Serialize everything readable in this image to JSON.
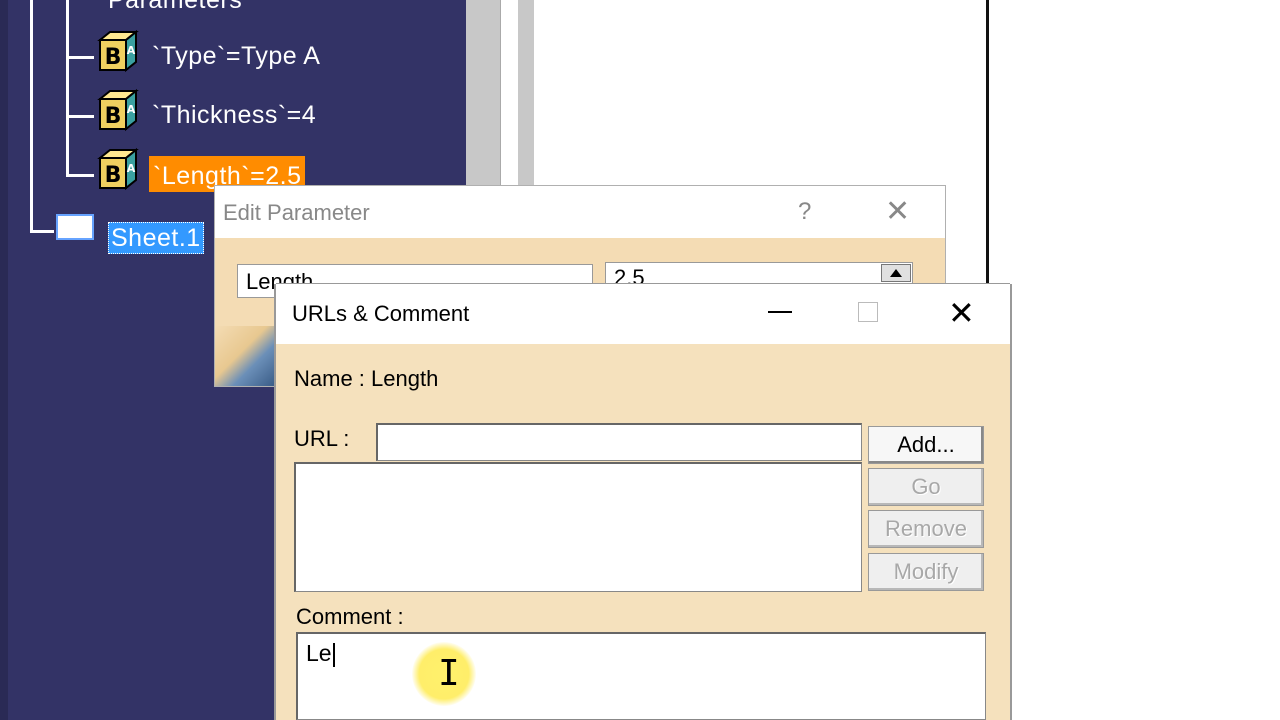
{
  "tree": {
    "root_label": "Parameters",
    "items": [
      {
        "label": "`Type`=Type A",
        "icon": "parameter-icon",
        "selected": false
      },
      {
        "label": "`Thickness`=4",
        "icon": "parameter-icon",
        "selected": false
      },
      {
        "label": "`Length`=2.5",
        "icon": "parameter-icon",
        "selected": true
      }
    ],
    "sheet_label": "Sheet.1"
  },
  "edit_dialog": {
    "title": "Edit Parameter",
    "help_label": "?",
    "close_label": "✕",
    "name_value": "Length",
    "value_value": "2.5"
  },
  "urls_dialog": {
    "title": "URLs & Comment",
    "close_label": "✕",
    "name_text": "Name : Length",
    "url_label": "URL :",
    "url_value": "",
    "buttons": {
      "add": "Add...",
      "go": "Go",
      "remove": "Remove",
      "modify": "Modify"
    },
    "comment_label": "Comment :",
    "comment_value": "Le"
  },
  "colors": {
    "tree_bg": "#333366",
    "selected_bg": "#ff8c00",
    "sheet_selected_bg": "#3399ff",
    "dialog_bg": "#f5e1bd"
  }
}
